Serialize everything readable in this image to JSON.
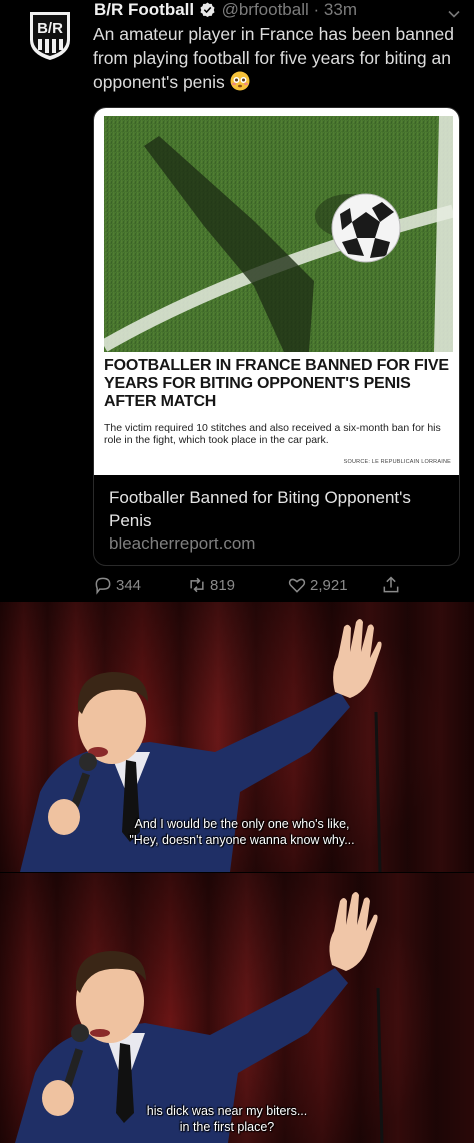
{
  "tweet": {
    "author_name": "B/R Football",
    "handle": "@brfootball",
    "separator": "·",
    "time": "33m",
    "avatar_text": "B/R",
    "text": "An amateur player in France has been banned from playing football for five years for biting an opponent's penis",
    "emoji": "flushed-face-emoji",
    "card": {
      "image_headline": "FOOTBALLER IN FRANCE BANNED FOR FIVE YEARS FOR BITING OPPONENT'S PENIS AFTER MATCH",
      "image_subline": "The victim required 10 stitches and also received a six-month ban for his role in the fight, which took place in the car park.",
      "image_source": "SOURCE: LE REPUBLICAIN LORRAINE",
      "title": "Footballer Banned for Biting Opponent's Penis",
      "domain": "bleacherreport.com"
    },
    "actions": {
      "replies": "344",
      "retweets": "819",
      "likes": "2,921"
    }
  },
  "panels": [
    {
      "caption_line1": "And I would be the only one who's like,",
      "caption_line2": "\"Hey, doesn't anyone wanna know why..."
    },
    {
      "caption_line1": "his dick was near my biters...",
      "caption_line2": "in the first place?"
    }
  ],
  "colors": {
    "background": "#000000",
    "curtain": "#5a1212",
    "suit": "#1f2f66"
  }
}
